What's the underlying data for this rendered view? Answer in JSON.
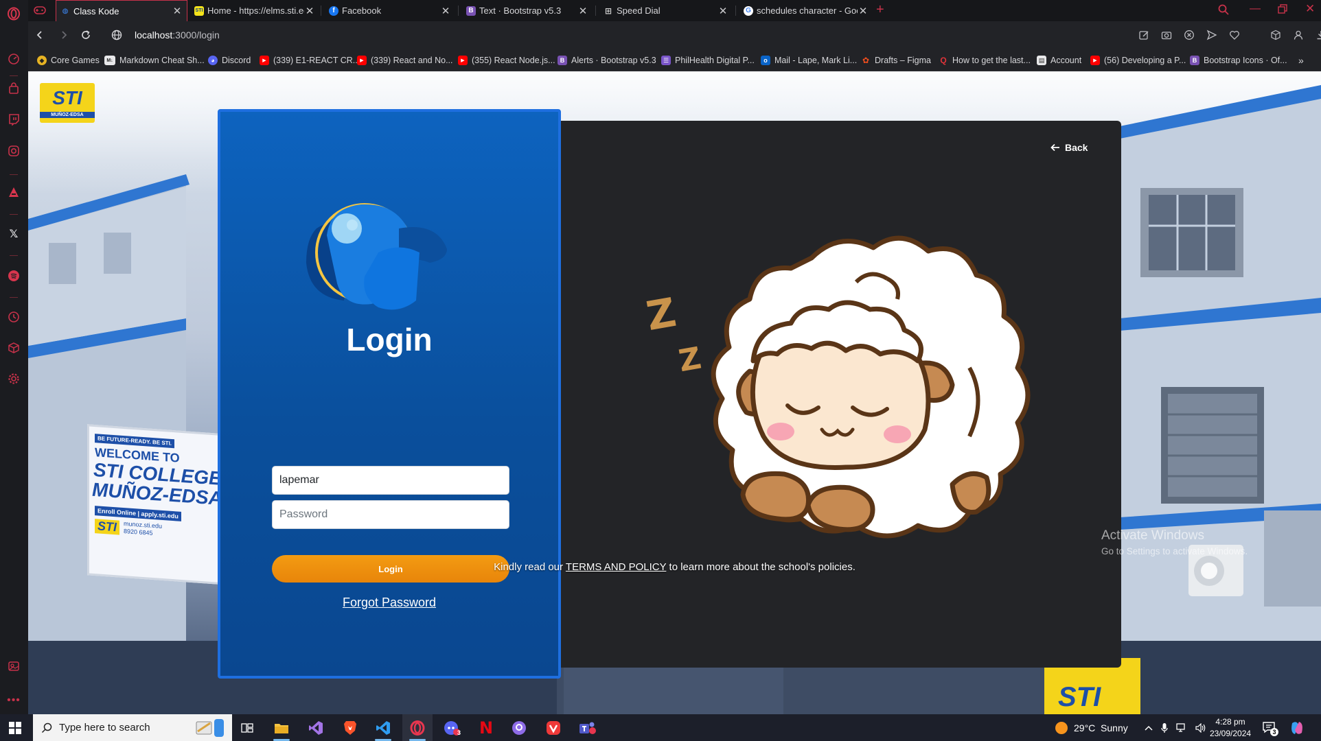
{
  "tabs": [
    {
      "title": "Class Kode",
      "active": true,
      "favicon": "class-kode"
    },
    {
      "title": "Home - https://elms.sti.edu",
      "favicon": "sti"
    },
    {
      "title": "Facebook",
      "favicon": "facebook"
    },
    {
      "title": "Text · Bootstrap v5.3",
      "favicon": "bootstrap"
    },
    {
      "title": "Speed Dial",
      "favicon": "grid"
    },
    {
      "title": "schedules character - Goog",
      "favicon": "google"
    }
  ],
  "address_bar": {
    "url_host": "localhost",
    "url_rest": ":3000/login"
  },
  "bookmarks": [
    {
      "label": "Core Games",
      "icon": "core-games"
    },
    {
      "label": "Markdown Cheat Sh...",
      "icon": "markdown"
    },
    {
      "label": "Discord",
      "icon": "discord"
    },
    {
      "label": "(339) E1-REACT CR...",
      "icon": "youtube"
    },
    {
      "label": "(339) React and No...",
      "icon": "youtube"
    },
    {
      "label": "(355) React Node.js...",
      "icon": "youtube"
    },
    {
      "label": "Alerts · Bootstrap v5.3",
      "icon": "bootstrap"
    },
    {
      "label": "PhilHealth Digital P...",
      "icon": "philhealth"
    },
    {
      "label": "Mail - Lape, Mark Li...",
      "icon": "outlook"
    },
    {
      "label": "Drafts – Figma",
      "icon": "figma"
    },
    {
      "label": "How to get the last...",
      "icon": "quora"
    },
    {
      "label": "Account",
      "icon": "account"
    },
    {
      "label": "(56) Developing a P...",
      "icon": "youtube"
    },
    {
      "label": "Bootstrap Icons · Of...",
      "icon": "bootstrap"
    }
  ],
  "page": {
    "logo_text": "STI",
    "logo_subtext": "MUÑOZ-EDSA",
    "login": {
      "title": "Login",
      "username_value": "lapemar",
      "password_placeholder": "Password",
      "button_label": "Login",
      "forgot_link": "Forgot Password"
    },
    "back_label": "Back",
    "illustration": "sleeping-sheep",
    "zzz": [
      "Z",
      "Z"
    ],
    "footer": {
      "prefix": "Kindly read our ",
      "link": "TERMS AND POLICY",
      "suffix": " to learn more about the school's policies."
    },
    "banner": {
      "ribbon": "BE FUTURE-READY. BE STI.",
      "line1": "WELCOME TO",
      "line2": "STI COLLEGE",
      "line3": "MUÑOZ-EDSA",
      "enroll": "Enroll Online | apply.sti.edu",
      "web": "munoz.sti.edu",
      "phone": "8920 6845",
      "logo": "STI"
    },
    "watermark": {
      "title": "Activate Windows",
      "subtitle": "Go to Settings to activate Windows."
    }
  },
  "taskbar": {
    "search_placeholder": "Type here to search",
    "weather": "29°C  Sunny",
    "time": "4:28 pm",
    "date": "23/09/2024",
    "notification_count": "3",
    "apps": [
      "task-view",
      "file-explorer",
      "visual-studio",
      "brave",
      "vscode",
      "opera",
      "discord",
      "netflix",
      "github-desktop",
      "vivaldi",
      "teams"
    ]
  },
  "colors": {
    "opera_red": "#c8324a",
    "card_blue": "#0d63bf",
    "login_orange": "#f39b12",
    "dark_panel": "#232427"
  }
}
